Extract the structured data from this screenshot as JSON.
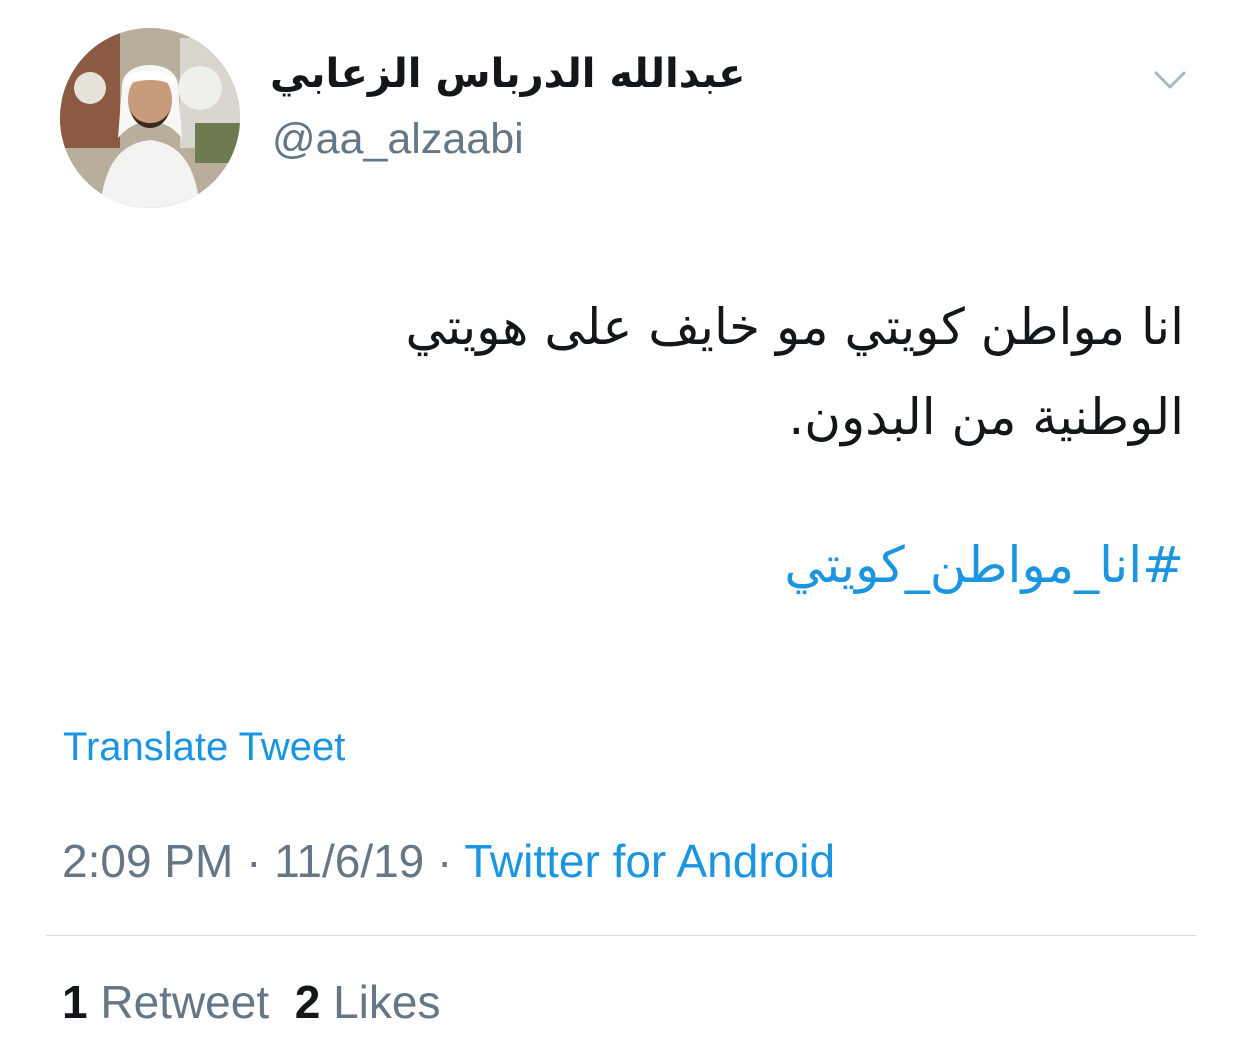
{
  "user": {
    "display_name": "عبدالله الدرباس الزعابي",
    "handle": "@aa_alzaabi",
    "avatar_icon": "profile-photo"
  },
  "tweet": {
    "text_line_1": "انا مواطن كويتي مو خايف على هويتي",
    "text_line_2": "الوطنية من البدون.",
    "hashtag": "#انا_مواطن_كويتي",
    "translate_label": "Translate Tweet",
    "time": "2:09 PM",
    "date": "11/6/19",
    "separator": "·",
    "source": "Twitter for Android"
  },
  "stats": {
    "retweet_count": "1",
    "retweet_label": "Retweet",
    "like_count": "2",
    "like_label": "Likes"
  },
  "menu": {
    "icon": "chevron-down-icon"
  },
  "colors": {
    "link": "#1b95e0",
    "text": "#14171a",
    "secondary": "#657786",
    "divider": "#d8dde1"
  }
}
